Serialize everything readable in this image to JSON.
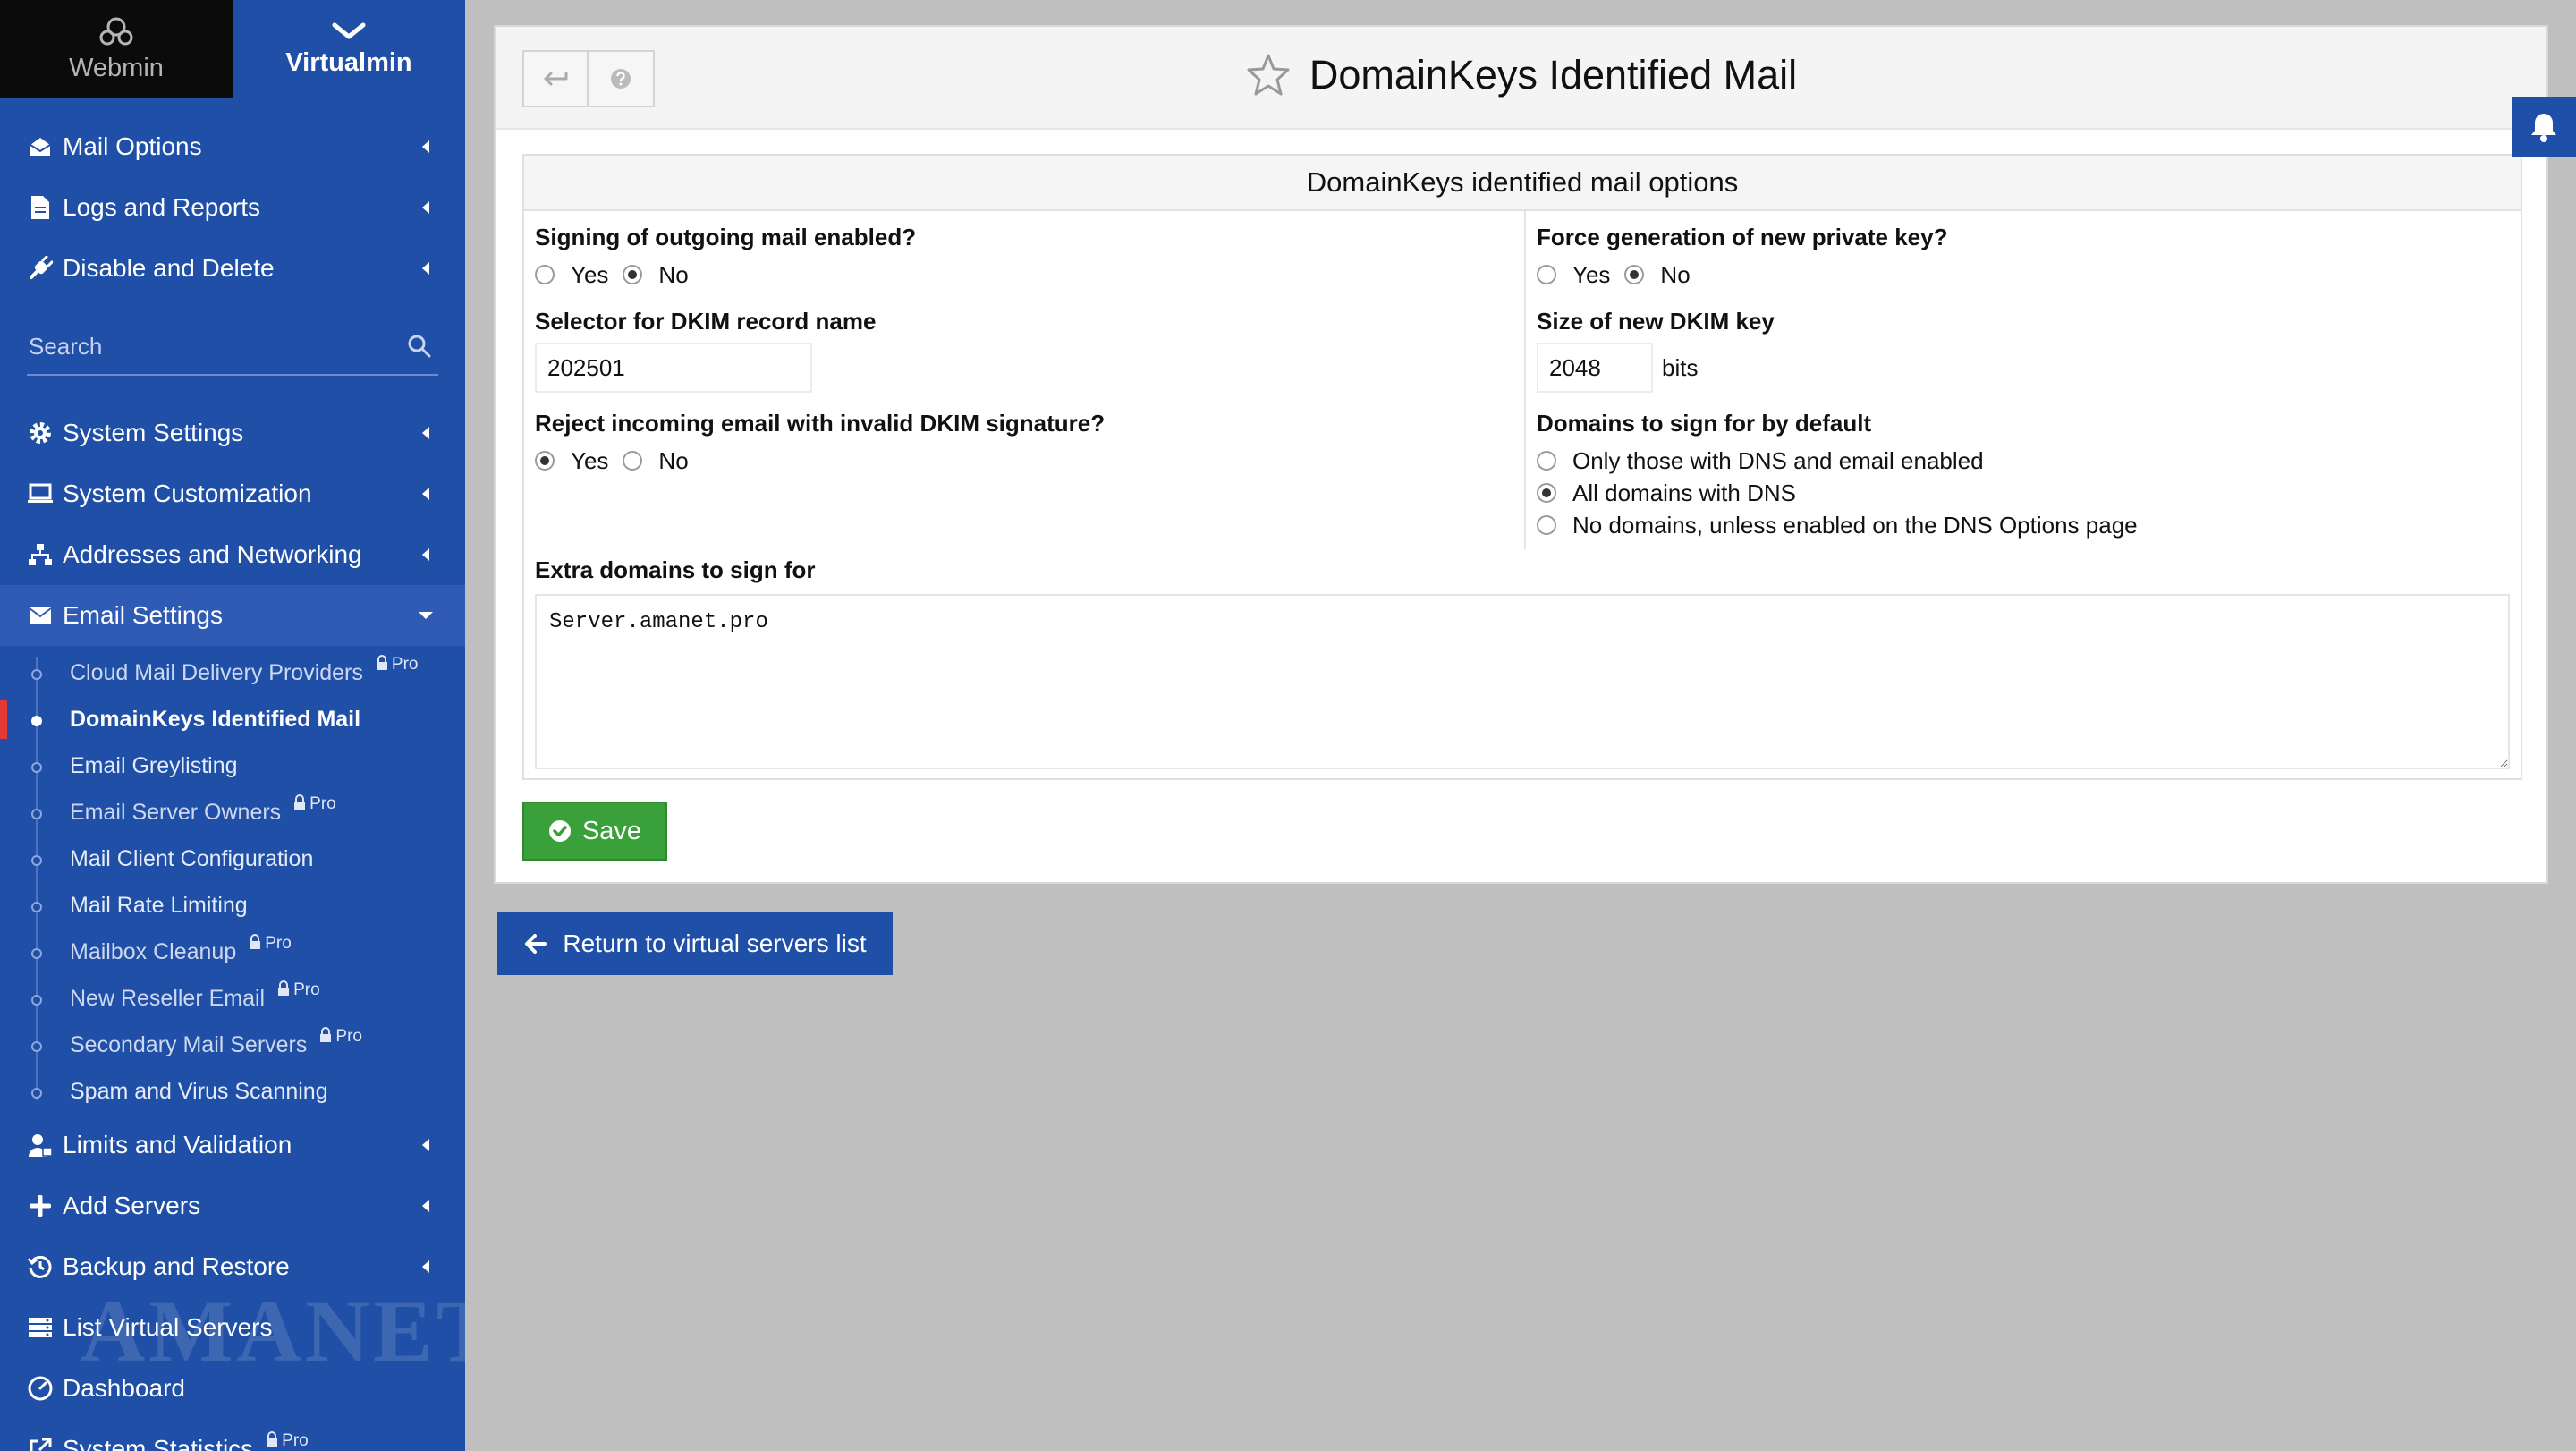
{
  "sidebar": {
    "top_tabs": [
      {
        "label": "Webmin"
      },
      {
        "label": "Virtualmin"
      }
    ],
    "items_top": [
      {
        "label": "Mail Options",
        "icon": "envelope-open-icon"
      },
      {
        "label": "Logs and Reports",
        "icon": "file-icon"
      },
      {
        "label": "Disable and Delete",
        "icon": "plug-icon"
      }
    ],
    "search": {
      "placeholder": "Search"
    },
    "items_mid": [
      {
        "label": "System Settings",
        "icon": "gear-icon"
      },
      {
        "label": "System Customization",
        "icon": "laptop-icon"
      },
      {
        "label": "Addresses and Networking",
        "icon": "network-icon"
      },
      {
        "label": "Email Settings",
        "icon": "envelope-icon"
      }
    ],
    "email_settings_items": [
      {
        "label": "Cloud Mail Delivery Providers",
        "pro": "Pro"
      },
      {
        "label": "DomainKeys Identified Mail"
      },
      {
        "label": "Email Greylisting"
      },
      {
        "label": "Email Server Owners",
        "pro": "Pro"
      },
      {
        "label": "Mail Client Configuration"
      },
      {
        "label": "Mail Rate Limiting"
      },
      {
        "label": "Mailbox Cleanup",
        "pro": "Pro"
      },
      {
        "label": "New Reseller Email",
        "pro": "Pro"
      },
      {
        "label": "Secondary Mail Servers",
        "pro": "Pro"
      },
      {
        "label": "Spam and Virus Scanning"
      }
    ],
    "items_bottom": [
      {
        "label": "Limits and Validation",
        "icon": "user-lock-icon"
      },
      {
        "label": "Add Servers",
        "icon": "plus-icon"
      },
      {
        "label": "Backup and Restore",
        "icon": "history-icon"
      },
      {
        "label": "List Virtual Servers",
        "icon": "server-list-icon"
      },
      {
        "label": "Dashboard",
        "icon": "dashboard-icon"
      },
      {
        "label": "System Statistics",
        "icon": "external-link-icon",
        "pro": "Pro"
      }
    ]
  },
  "header": {
    "title": "DomainKeys Identified Mail"
  },
  "panel": {
    "title": "DomainKeys identified mail options",
    "signing": {
      "label": "Signing of outgoing mail enabled?",
      "options": [
        "Yes",
        "No"
      ],
      "selected": "No"
    },
    "selector": {
      "label": "Selector for DKIM record name",
      "value": "202501"
    },
    "reject": {
      "label": "Reject incoming email with invalid DKIM signature?",
      "options": [
        "Yes",
        "No"
      ],
      "selected": "Yes"
    },
    "force_key": {
      "label": "Force generation of new private key?",
      "options": [
        "Yes",
        "No"
      ],
      "selected": "No"
    },
    "key_size": {
      "label": "Size of new DKIM key",
      "value": "2048",
      "suffix": "bits"
    },
    "default_domains": {
      "label": "Domains to sign for by default",
      "options": [
        "Only those with DNS and email enabled",
        "All domains with DNS",
        "No domains, unless enabled on the DNS Options page"
      ],
      "selected": "All domains with DNS"
    },
    "extra_domains": {
      "label": "Extra domains to sign for",
      "value": "Server.amanet.pro"
    }
  },
  "buttons": {
    "save": "Save",
    "return": "Return to virtual servers list"
  },
  "watermark": "AMANET",
  "colors": {
    "sidebar_bg": "#1f4fa6",
    "save_green": "#3aa13a",
    "active_marker": "#e53935"
  }
}
